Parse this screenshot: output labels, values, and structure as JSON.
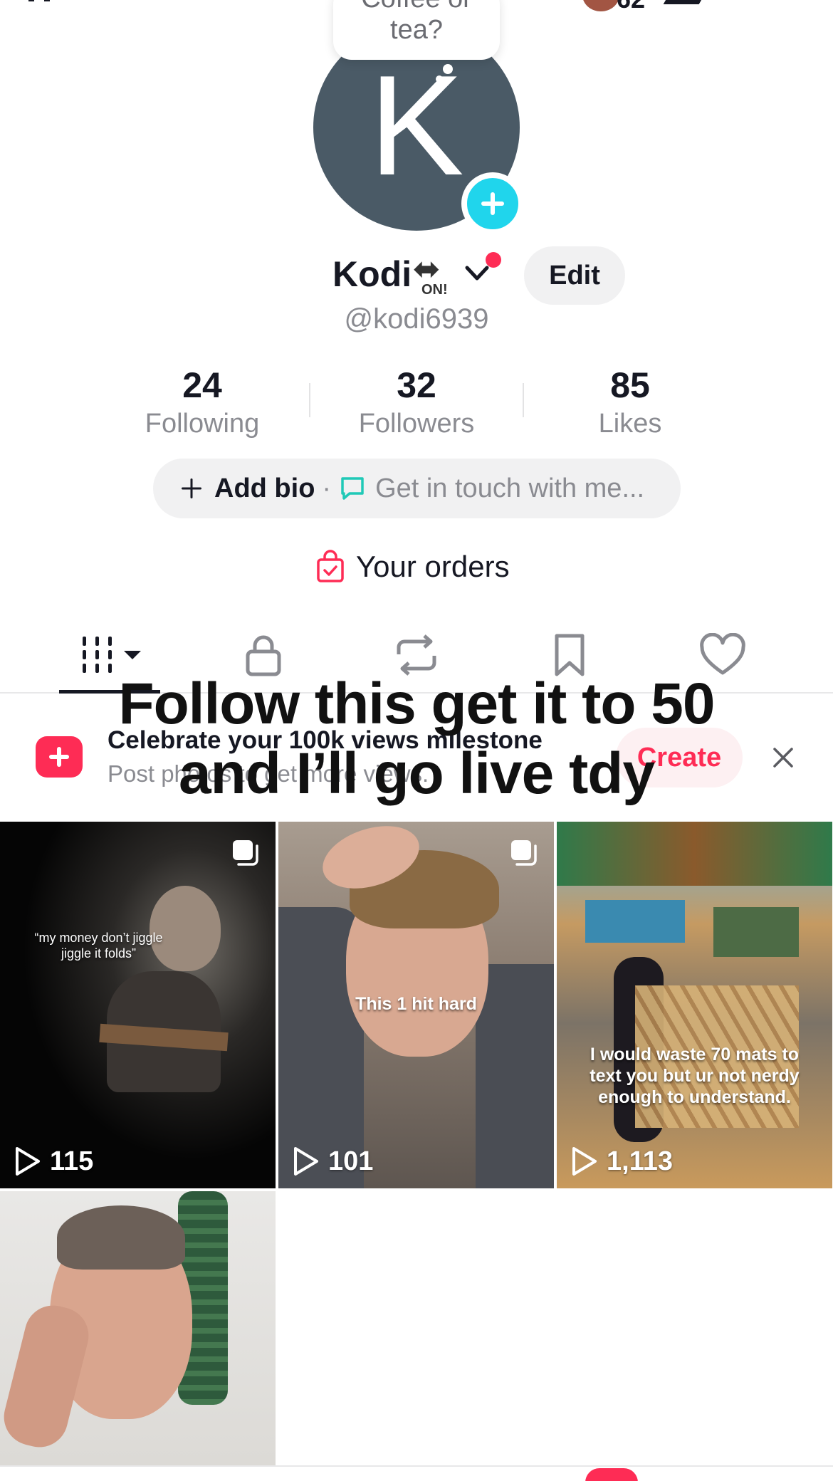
{
  "profile": {
    "note": "Coffee or tea?",
    "avatar_letter": "K",
    "display_name": "Kodi",
    "name_emoji_badge": "ON!",
    "username": "@kodi6939",
    "edit_label": "Edit"
  },
  "stats": [
    {
      "value": "24",
      "label": "Following"
    },
    {
      "value": "32",
      "label": "Followers"
    },
    {
      "value": "85",
      "label": "Likes"
    }
  ],
  "bio": {
    "add_label": "Add bio",
    "separator": "·",
    "contact_label": "Get in touch with me..."
  },
  "orders": {
    "label": "Your orders"
  },
  "tabs": [
    {
      "icon": "videos-grid-icon",
      "active": true
    },
    {
      "icon": "lock-icon",
      "active": false
    },
    {
      "icon": "repost-icon",
      "active": false
    },
    {
      "icon": "bookmark-icon",
      "active": false
    },
    {
      "icon": "heart-icon",
      "active": false
    }
  ],
  "banner": {
    "title": "Celebrate your 100k views milestone",
    "subtitle": "Post photos to get more views.",
    "create_label": "Create"
  },
  "overlay_caption": {
    "line1": "Follow this get it to 50",
    "line2": "and I’ll go live tdy"
  },
  "videos": [
    {
      "caption_line1": "“my money don’t jiggle",
      "caption_line2": "jiggle it folds”",
      "views": "115"
    },
    {
      "caption_line1": "This 1 hit hard",
      "views": "101"
    },
    {
      "caption_line1": "I would waste 70 mats to",
      "caption_line2": "text you but ur not nerdy",
      "caption_line3": "enough to understand.",
      "views": "1,113"
    },
    {}
  ],
  "status_bar": {
    "friend_count": "62"
  },
  "colors": {
    "accent": "#fe2c55",
    "add_avatar": "#20d5ec",
    "avatar_bg": "#4a5a66",
    "muted": "#8a8b91"
  }
}
